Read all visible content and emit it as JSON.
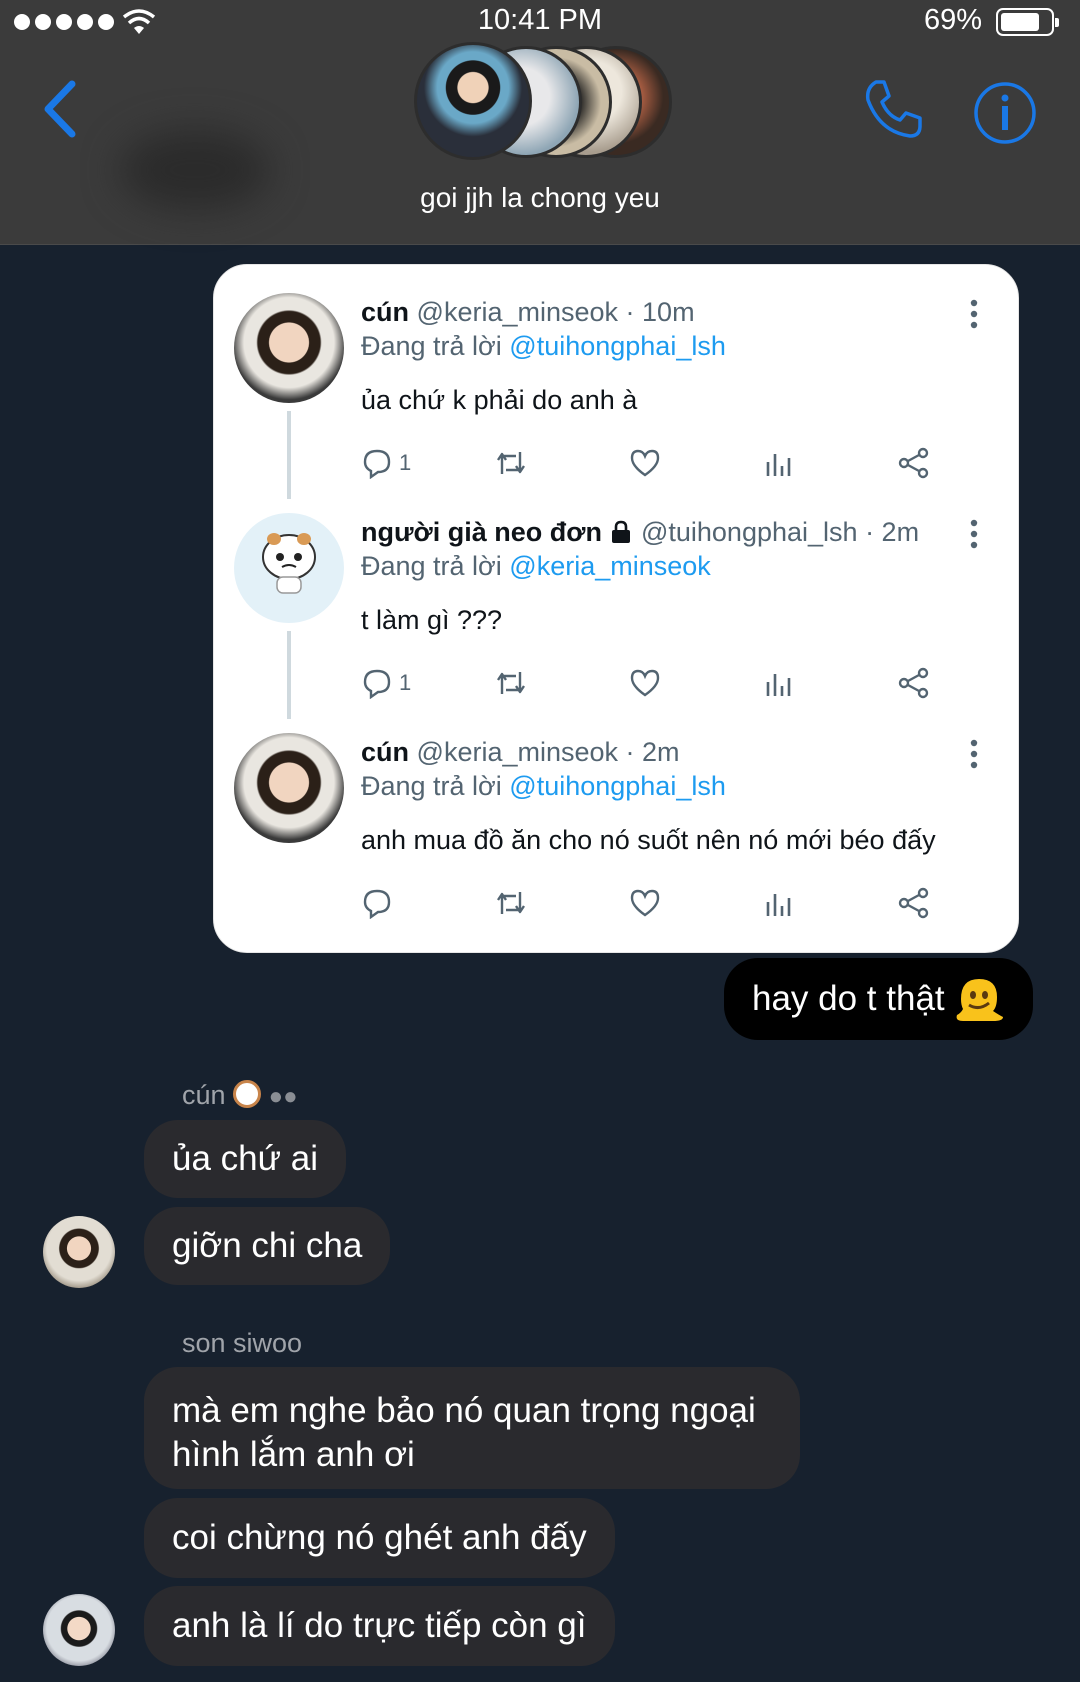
{
  "status_bar": {
    "time": "10:41 PM",
    "battery": "69%"
  },
  "header": {
    "group_name": "goi jjh la chong yeu",
    "icons": [
      "back-chevron-icon",
      "phone-icon",
      "info-icon"
    ]
  },
  "tweets": [
    {
      "name": "cún",
      "handle": "@keria_minseok",
      "time": "· 10m",
      "replying_prefix": "Đang trả lời",
      "replying_to": "@tuihongphai_lsh",
      "text": "ủa chứ k phải do anh à",
      "reply_count": "1"
    },
    {
      "name": "người già neo đơn",
      "handle": "@tuihongphai_lsh",
      "time": "· 2m",
      "replying_prefix": "Đang trả lời",
      "replying_to": "@keria_minseok",
      "text": "t làm gì ???",
      "reply_count": "1"
    },
    {
      "name": "cún",
      "handle": "@keria_minseok",
      "time": "· 2m",
      "replying_prefix": "Đang trả lời",
      "replying_to": "@tuihongphai_lsh",
      "text": "anh mua đồ ăn cho nó suốt nên nó mới béo đấy",
      "reply_count": ""
    }
  ],
  "messages": {
    "mine": "hay do t thật",
    "sender1": "cún",
    "sender1_msgs": [
      "ủa chứ ai",
      "giỡn chi cha"
    ],
    "sender2": "son siwoo",
    "sender2_msgs": [
      "mà em nghe bảo nó quan trọng ngoại hình lắm anh ơi",
      "coi chừng nó ghét anh đấy",
      "anh là lí do trực tiếp còn gì"
    ]
  },
  "colors": {
    "chat_bg": "#17212e",
    "header_bg": "#3b3b3b",
    "accent_blue": "#1a78e6",
    "twitter_blue": "#1d9bf0",
    "bubble_other": "#2a2a2e",
    "bubble_mine": "#000000"
  }
}
